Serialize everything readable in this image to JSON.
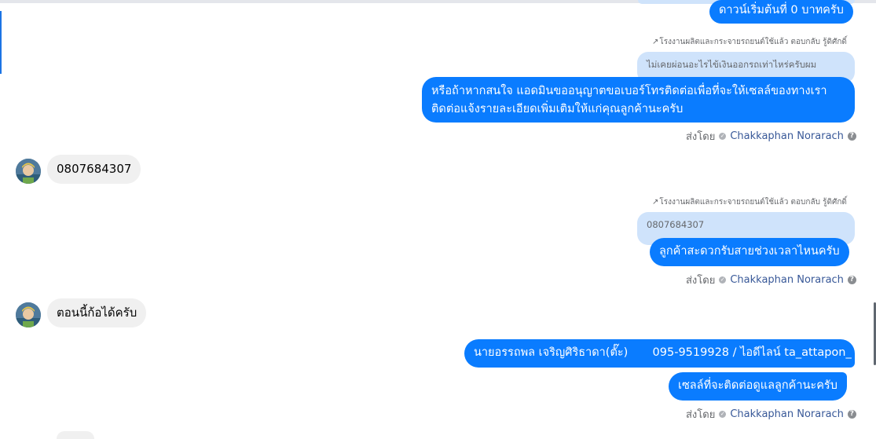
{
  "messages": {
    "m1": {
      "text": "ดาวน์เริ่มต้นที่ 0 บาทครับ"
    },
    "r1": {
      "reply_meta": "โรงงานผลิตและกระจายรถยนต์ใช้แล้ว ตอบกลับ รู้ดิศักดิ์",
      "quote": "ไม่เคยผ่อนอะไรไข้เงินออกรถเท่าไหร่ครับผม",
      "line1": "หรือถ้าหากสนใจ แอดมินขออนุญาตขอเบอร์โทรติดต่อเพื่อที่จะให้เซลล์ของทางเรา",
      "line2": "ติดต่อแจ้งรายละเอียดเพิ่มเติมให้แก่คุณลูกค้านะครับ"
    },
    "sent_by_label": "ส่งโดย",
    "sent_by_name": "Chakkaphan Norarach",
    "in1": {
      "text": "0807684307"
    },
    "r2": {
      "reply_meta": "โรงงานผลิตและกระจายรถยนต์ใช้แล้ว ตอบกลับ รู้ดิศักดิ์",
      "quote": "0807684307",
      "text": "ลูกค้าสะดวกรับสายช่วงเวลาไหนครับ"
    },
    "in2": {
      "text": "ตอนนี้ก้อได้ครับ"
    },
    "m3": {
      "name": "นายอรรถพล เจริญศิริธาดา(ตั๊ะ)",
      "contact": "095-9519928 / ไอดีไลน์ ta_attapon_"
    },
    "m4": {
      "text": "เซลล์ที่จะติดต่อดูแลลูกค้านะครับ"
    }
  },
  "colors": {
    "outgoing_bubble": "#0a7cff",
    "incoming_bubble": "#f0f0f0",
    "quote_bubble": "#cfe3fb",
    "sender_name": "#385898"
  }
}
